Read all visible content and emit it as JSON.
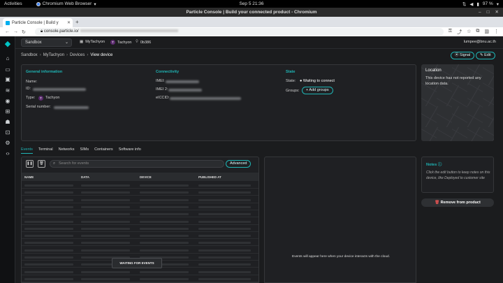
{
  "os": {
    "activities": "Activities",
    "app_name": "Chromium Web Browser",
    "clock": "Sep 5  21:36",
    "battery": "97 %"
  },
  "window": {
    "title": "Particle Console | Build your connected product - Chromium"
  },
  "browser": {
    "tab_title": "Particle Console | Build y",
    "url_prefix": "console.particle.io/"
  },
  "topnav": {
    "org": "Sandbox",
    "product": "MyTachyon",
    "device_badge": "T",
    "device_type": "Tachyon",
    "build": "0b386",
    "user_email": "lumpee@bnu.ac.th"
  },
  "breadcrumb": [
    "Sandbox",
    "MyTachyon",
    "Devices",
    "View device"
  ],
  "actions": {
    "signal": "Signal",
    "edit": "Edit"
  },
  "general": {
    "title": "General information",
    "name_label": "Name:",
    "id_label": "ID:",
    "type_label": "Type:",
    "type_badge": "T",
    "type_value": "Tachyon",
    "serial_label": "Serial number:"
  },
  "connectivity": {
    "title": "Connectivity",
    "imei1_label": "IMEI:",
    "imei2_label": "IMEI 2:",
    "eiccid_label": "eICCID:"
  },
  "state": {
    "title": "State",
    "state_label": "State:",
    "state_value": "Waiting to connect",
    "groups_label": "Groups:",
    "add_groups": "+ Add groups"
  },
  "location": {
    "title": "Location",
    "message": "This device has not reported any location data."
  },
  "tabs": [
    "Events",
    "Terminal",
    "Networks",
    "SIMs",
    "Containers",
    "Software info"
  ],
  "events": {
    "search_placeholder": "Search for events",
    "advanced": "Advanced",
    "columns": [
      "NAME",
      "DATA",
      "DEVICE",
      "PUBLISHED AT"
    ],
    "waiting": "WAITING FOR EVENTS",
    "detail_message": "Events will appear here when your device interacts with the cloud."
  },
  "notes": {
    "title": "Notes",
    "body": "Click the edit button to keep notes on this device, like Deployed to customer site"
  },
  "remove_button": "Remove from product",
  "icons": [
    "particle-logo-icon",
    "home-icon",
    "terminal-icon",
    "devices-icon",
    "location-icon",
    "integrations-icon",
    "team-icon",
    "apps-icon",
    "code-icon"
  ]
}
